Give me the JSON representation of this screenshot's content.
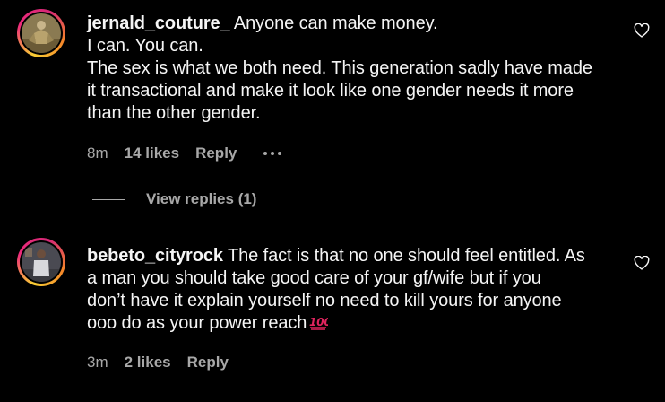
{
  "comments": [
    {
      "username": "jernald_couture_",
      "first_line": "Anyone can make money.",
      "lines": [
        "I can. You can.",
        "The sex is what we both need. This generation sadly have made",
        "it transactional and make it look like one gender needs it more",
        "than the other gender."
      ],
      "time": "8m",
      "likes": "14 likes",
      "reply_label": "Reply",
      "more_icon": "more-options-icon",
      "like_icon": "heart-outline-icon"
    },
    {
      "username": "bebeto_cityrock",
      "first_line": "The fact is that no one should feel entitled. As",
      "lines": [
        "a man you should take good care of your gf/wife but if you",
        "don’t have it explain yourself no need to kill yours for anyone",
        "ooo do as your power reach"
      ],
      "emoji": "100-points-emoji",
      "time": "3m",
      "likes": "2 likes",
      "reply_label": "Reply",
      "like_icon": "heart-outline-icon"
    }
  ],
  "view_replies": "View replies (1)",
  "colors": {
    "background": "#000000",
    "text": "#f5f5f5",
    "meta": "#a8a8a8",
    "emoji_red": "#e0245e"
  }
}
